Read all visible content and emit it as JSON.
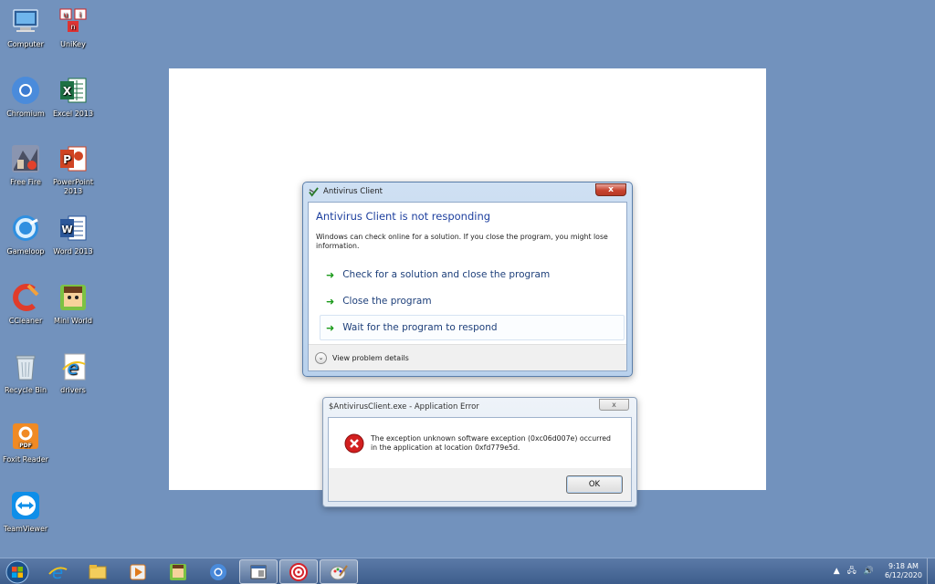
{
  "desktop": {
    "icons": [
      {
        "label": "Computer",
        "icon": "computer-icon"
      },
      {
        "label": "UniKey",
        "icon": "unikey-icon"
      },
      {
        "label": "Chromium",
        "icon": "chromium-icon"
      },
      {
        "label": "Excel 2013",
        "icon": "excel-icon"
      },
      {
        "label": "Free Fire",
        "icon": "free-fire-icon"
      },
      {
        "label": "PowerPoint 2013",
        "icon": "powerpoint-icon"
      },
      {
        "label": "Gameloop",
        "icon": "gameloop-icon"
      },
      {
        "label": "Word 2013",
        "icon": "word-icon"
      },
      {
        "label": "CCleaner",
        "icon": "ccleaner-icon"
      },
      {
        "label": "Mini World",
        "icon": "mini-world-icon"
      },
      {
        "label": "Recycle Bin",
        "icon": "recycle-bin-icon"
      },
      {
        "label": "drivers",
        "icon": "ie-shortcut-icon"
      },
      {
        "label": "Foxit Reader",
        "icon": "foxit-icon"
      },
      {
        "label": "TeamViewer",
        "icon": "teamviewer-icon"
      }
    ]
  },
  "not_responding_dialog": {
    "title": "Antivirus Client",
    "close_label": "x",
    "heading": "Antivirus Client is not responding",
    "message": "Windows can check online for a solution. If you close the program, you might lose information.",
    "options": [
      {
        "label": "Check for a solution and close the program"
      },
      {
        "label": "Close the program"
      },
      {
        "label": "Wait for the program to respond"
      }
    ],
    "details_label": "View problem details"
  },
  "error_dialog": {
    "title": "$AntivirusClient.exe - Application Error",
    "close_label": "x",
    "message": "The exception unknown software exception (0xc06d007e) occurred in the application at location 0xfd779e5d.",
    "ok_label": "OK"
  },
  "taskbar": {
    "time": "9:18 AM",
    "date": "6/12/2020",
    "tray_arrow": "▲"
  },
  "colors": {
    "desktop_bg": "#7292bd",
    "heading_blue": "#1d3f9e",
    "arrow_green": "#1a9a1a",
    "error_red": "#d21f1f"
  }
}
